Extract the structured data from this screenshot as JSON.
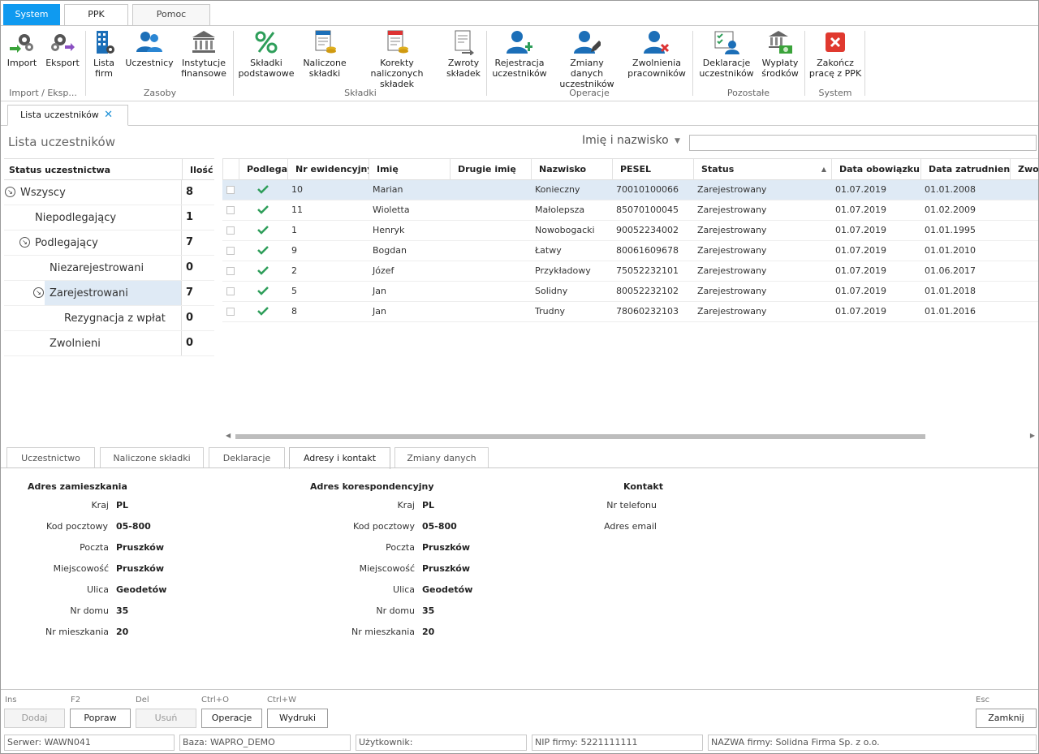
{
  "ribbon_tabs": {
    "system": "System",
    "ppk": "PPK",
    "pomoc": "Pomoc"
  },
  "ribbon": {
    "import": "Import",
    "eksport": "Eksport",
    "lista_firm": "Lista\nfirm",
    "uczestnicy": "Uczestnicy",
    "instytucje": "Instytucje\nfinansowe",
    "skladki_podst": "Składki\npodstawowe",
    "naliczone": "Naliczone\nskładki",
    "korekty": "Korekty naliczonych\nskładek",
    "zwroty": "Zwroty\nskładek",
    "rejestracja": "Rejestracja\nuczestników",
    "zmiany": "Zmiany danych\nuczestników",
    "zwolnienia": "Zwolnienia\npracowników",
    "deklaracje": "Deklaracje\nuczestników",
    "wyplaty": "Wypłaty\nśrodków",
    "zakoncz": "Zakończ\npracę z PPK",
    "groups": {
      "import": "Import / Eksp...",
      "zasoby": "Zasoby",
      "skladki": "Składki",
      "operacje": "Operacje",
      "pozostale": "Pozostałe",
      "system": "System"
    }
  },
  "doc_tab": {
    "label": "Lista uczestników",
    "close": "✕"
  },
  "page_title": "Lista uczestników",
  "search": {
    "label": "Imię i nazwisko",
    "value": ""
  },
  "status_panel": {
    "col_status": "Status uczestnictwa",
    "col_count": "Ilość",
    "rows": [
      {
        "label": "Wszyscy",
        "count": "8"
      },
      {
        "label": "Niepodlegający",
        "count": "1"
      },
      {
        "label": "Podlegający",
        "count": "7"
      },
      {
        "label": "Niezarejestrowani",
        "count": "0"
      },
      {
        "label": "Zarejestrowani",
        "count": "7"
      },
      {
        "label": "Rezygnacja z wpłat",
        "count": "0"
      },
      {
        "label": "Zwolnieni",
        "count": "0"
      }
    ]
  },
  "grid": {
    "headers": [
      "Podlega",
      "Nr ewidencyjny",
      "Imię",
      "Drugie imię",
      "Nazwisko",
      "PESEL",
      "Status",
      "Data obowiązku",
      "Data zatrudnienia",
      "Zwol"
    ],
    "rows": [
      {
        "nr": "10",
        "imie": "Marian",
        "drugie": "",
        "nazwisko": "Konieczny",
        "pesel": "70010100066",
        "status": "Zarejestrowany",
        "data_ob": "01.07.2019",
        "data_zat": "01.01.2008"
      },
      {
        "nr": "11",
        "imie": "Wioletta",
        "drugie": "",
        "nazwisko": "Małolepsza",
        "pesel": "85070100045",
        "status": "Zarejestrowany",
        "data_ob": "01.07.2019",
        "data_zat": "01.02.2009"
      },
      {
        "nr": "1",
        "imie": "Henryk",
        "drugie": "",
        "nazwisko": "Nowobogacki",
        "pesel": "90052234002",
        "status": "Zarejestrowany",
        "data_ob": "01.07.2019",
        "data_zat": "01.01.1995"
      },
      {
        "nr": "9",
        "imie": "Bogdan",
        "drugie": "",
        "nazwisko": "Łatwy",
        "pesel": "80061609678",
        "status": "Zarejestrowany",
        "data_ob": "01.07.2019",
        "data_zat": "01.01.2010"
      },
      {
        "nr": "2",
        "imie": "Józef",
        "drugie": "",
        "nazwisko": "Przykładowy",
        "pesel": "75052232101",
        "status": "Zarejestrowany",
        "data_ob": "01.07.2019",
        "data_zat": "01.06.2017"
      },
      {
        "nr": "5",
        "imie": "Jan",
        "drugie": "",
        "nazwisko": "Solidny",
        "pesel": "80052232102",
        "status": "Zarejestrowany",
        "data_ob": "01.07.2019",
        "data_zat": "01.01.2018"
      },
      {
        "nr": "8",
        "imie": "Jan",
        "drugie": "",
        "nazwisko": "Trudny",
        "pesel": "78060232103",
        "status": "Zarejestrowany",
        "data_ob": "01.07.2019",
        "data_zat": "01.01.2016"
      }
    ]
  },
  "bottom_tabs": [
    "Uczestnictwo",
    "Naliczone składki",
    "Deklaracje",
    "Adresy i kontakt",
    "Zmiany danych"
  ],
  "addr_zam": {
    "title": "Adres zamieszkania",
    "kraj_l": "Kraj",
    "kraj": "PL",
    "kod_l": "Kod pocztowy",
    "kod": "05-800",
    "poczta_l": "Poczta",
    "poczta": "Pruszków",
    "miejsc_l": "Miejscowość",
    "miejsc": "Pruszków",
    "ulica_l": "Ulica",
    "ulica": "Geodetów",
    "dom_l": "Nr domu",
    "dom": "35",
    "mieszk_l": "Nr mieszkania",
    "mieszk": "20"
  },
  "addr_kor": {
    "title": "Adres korespondencyjny",
    "kraj_l": "Kraj",
    "kraj": "PL",
    "kod_l": "Kod pocztowy",
    "kod": "05-800",
    "poczta_l": "Poczta",
    "poczta": "Pruszków",
    "miejsc_l": "Miejscowość",
    "miejsc": "Pruszków",
    "ulica_l": "Ulica",
    "ulica": "Geodetów",
    "dom_l": "Nr domu",
    "dom": "35",
    "mieszk_l": "Nr mieszkania",
    "mieszk": "20"
  },
  "kontakt": {
    "title": "Kontakt",
    "tel_l": "Nr telefonu",
    "email_l": "Adres email"
  },
  "shortcuts": {
    "ins": "Ins",
    "f2": "F2",
    "del": "Del",
    "ctrlo": "Ctrl+O",
    "ctrlw": "Ctrl+W",
    "esc": "Esc"
  },
  "footer_buttons": {
    "dodaj": "Dodaj",
    "popraw": "Popraw",
    "usun": "Usuń",
    "operacje": "Operacje",
    "wydruki": "Wydruki",
    "zamknij": "Zamknij"
  },
  "statusbar": {
    "serwer": "Serwer: WAWN041",
    "baza": "Baza: WAPRO_DEMO",
    "uzytkownik": "Użytkownik:",
    "nip": "NIP firmy: 5221111111",
    "nazwa": "NAZWA firmy: Solidna Firma Sp. z o.o."
  },
  "colors": {
    "accent": "#0f9af0",
    "selection": "#dfeaf5",
    "check": "#2e9e5a",
    "close_red": "#e0392f"
  }
}
